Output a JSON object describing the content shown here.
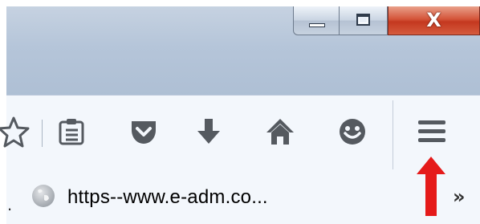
{
  "window_controls": {
    "minimize_icon": "minimize-icon",
    "maximize_icon": "maximize-icon",
    "close_label": "X"
  },
  "toolbar": {
    "buttons": [
      {
        "icon": "star-icon",
        "interactable": true
      },
      {
        "icon": "reading-list-icon",
        "interactable": true
      },
      {
        "icon": "pocket-icon",
        "interactable": true
      },
      {
        "icon": "download-icon",
        "interactable": true
      },
      {
        "icon": "home-icon",
        "interactable": true
      },
      {
        "icon": "smiley-icon",
        "interactable": true
      },
      {
        "icon": "hamburger-menu-icon",
        "interactable": true
      }
    ]
  },
  "bookmarks_bar": {
    "leading_dot": ".",
    "bookmark_title": "https--www.e-adm.co...",
    "overflow_label": "»"
  },
  "annotation": {
    "arrow_color": "#e51a1a",
    "points_to": "hamburger-menu-icon"
  },
  "colors": {
    "icon_gray": "#555a60",
    "close_red": "#c4381f",
    "titlebar_blue": "#b5c5d9"
  }
}
